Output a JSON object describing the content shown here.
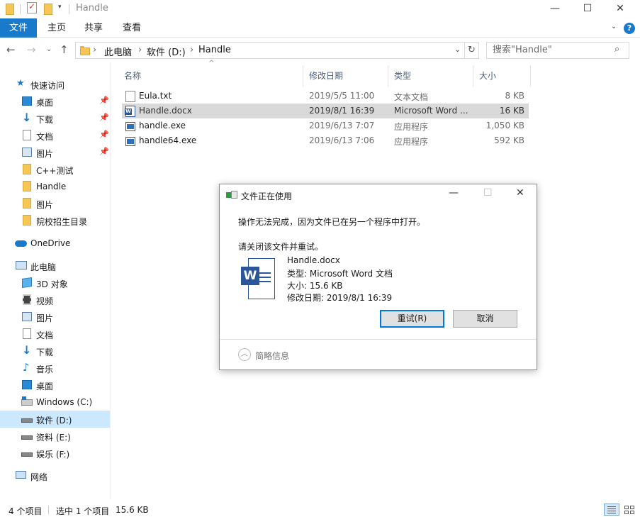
{
  "window": {
    "title": "Handle"
  },
  "ribbon": {
    "tabs": [
      "文件",
      "主页",
      "共享",
      "查看"
    ]
  },
  "address": {
    "crumbs": [
      "此电脑",
      "软件 (D:)",
      "Handle"
    ],
    "search_placeholder": "搜索\"Handle\""
  },
  "sidebar": {
    "quick_access": "快速访问",
    "quick_items": [
      "桌面",
      "下载",
      "文档",
      "图片",
      "C++测试",
      "Handle",
      "图片",
      "院校招生目录"
    ],
    "onedrive": "OneDrive",
    "this_pc": "此电脑",
    "pc_items": [
      "3D 对象",
      "视频",
      "图片",
      "文档",
      "下载",
      "音乐",
      "桌面",
      "Windows (C:)",
      "软件 (D:)",
      "资料 (E:)",
      "娱乐 (F:)"
    ],
    "network": "网络"
  },
  "files": {
    "headers": [
      "名称",
      "修改日期",
      "类型",
      "大小"
    ],
    "rows": [
      {
        "name": "Eula.txt",
        "date": "2019/5/5 11:00",
        "type": "文本文档",
        "size": "8 KB",
        "icon": "text-file-icon"
      },
      {
        "name": "Handle.docx",
        "date": "2019/8/1 16:39",
        "type": "Microsoft Word ...",
        "size": "16 KB",
        "icon": "word-file-icon",
        "selected": true
      },
      {
        "name": "handle.exe",
        "date": "2019/6/13 7:07",
        "type": "应用程序",
        "size": "1,050 KB",
        "icon": "exe-file-icon"
      },
      {
        "name": "handle64.exe",
        "date": "2019/6/13 7:06",
        "type": "应用程序",
        "size": "592 KB",
        "icon": "exe-file-icon"
      }
    ]
  },
  "status": {
    "count": "4 个项目",
    "selected": "选中 1 个项目",
    "size": "15.6 KB"
  },
  "dialog": {
    "title": "文件正在使用",
    "message": "操作无法完成，因为文件已在另一个程序中打开。",
    "instruction": "请关闭该文件并重试。",
    "file_name": "Handle.docx",
    "file_type": "类型: Microsoft Word 文档",
    "file_size": "大小: 15.6 KB",
    "file_date": "修改日期: 2019/8/1 16:39",
    "retry_label": "重试(R)",
    "cancel_label": "取消",
    "details_label": "简略信息"
  },
  "colors": {
    "accent": "#1979ca",
    "selected_row": "#d9d9d9",
    "selected_nav": "#cce8ff"
  }
}
